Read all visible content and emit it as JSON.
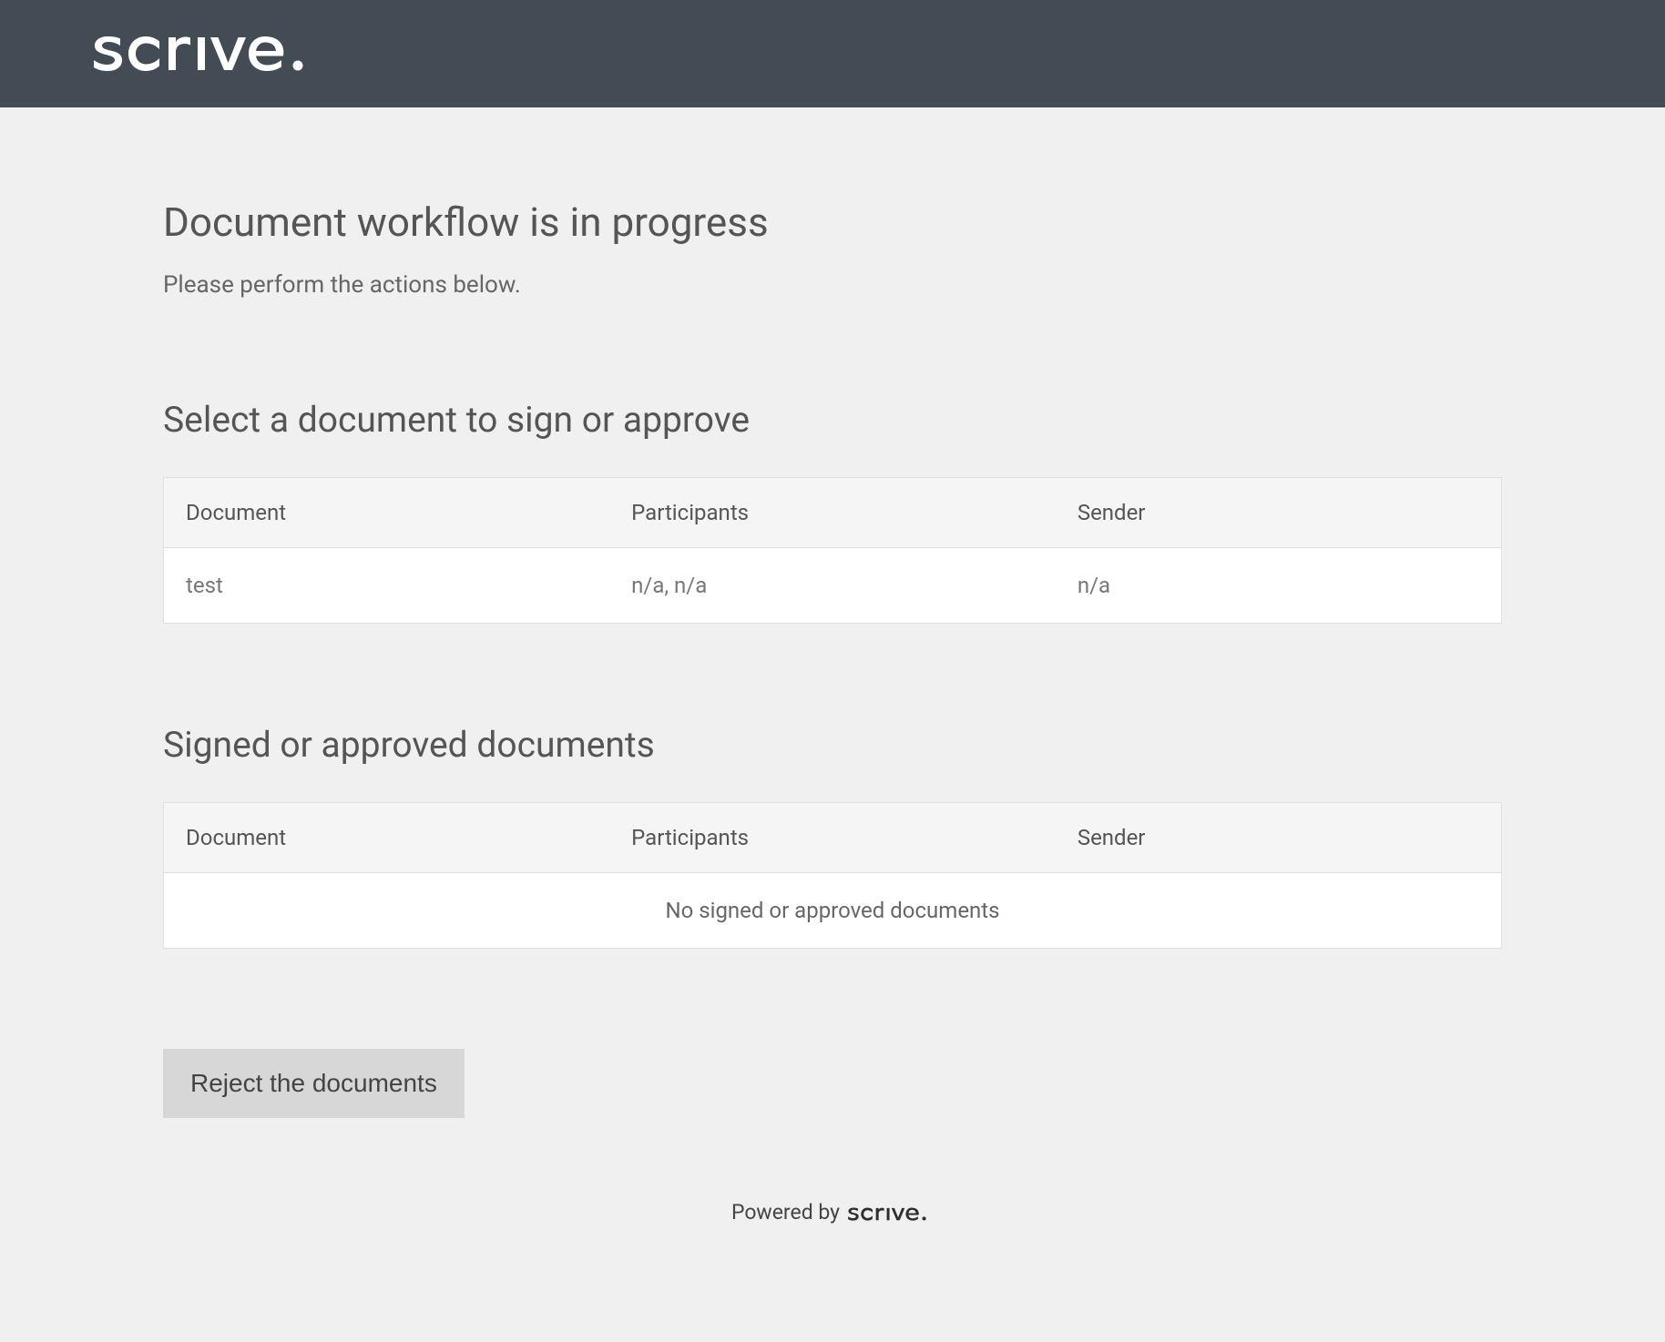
{
  "brand": {
    "name": "scrive"
  },
  "page": {
    "title": "Document workflow is in progress",
    "subtitle": "Please perform the actions below."
  },
  "select_section": {
    "heading": "Select a document to sign or approve",
    "columns": {
      "document": "Document",
      "participants": "Participants",
      "sender": "Sender"
    },
    "rows": [
      {
        "document": "test",
        "participants": "n/a, n/a",
        "sender": "n/a"
      }
    ]
  },
  "signed_section": {
    "heading": "Signed or approved documents",
    "columns": {
      "document": "Document",
      "participants": "Participants",
      "sender": "Sender"
    },
    "empty_message": "No signed or approved documents"
  },
  "actions": {
    "reject_label": "Reject the documents"
  },
  "footer": {
    "powered_by": "Powered by"
  }
}
